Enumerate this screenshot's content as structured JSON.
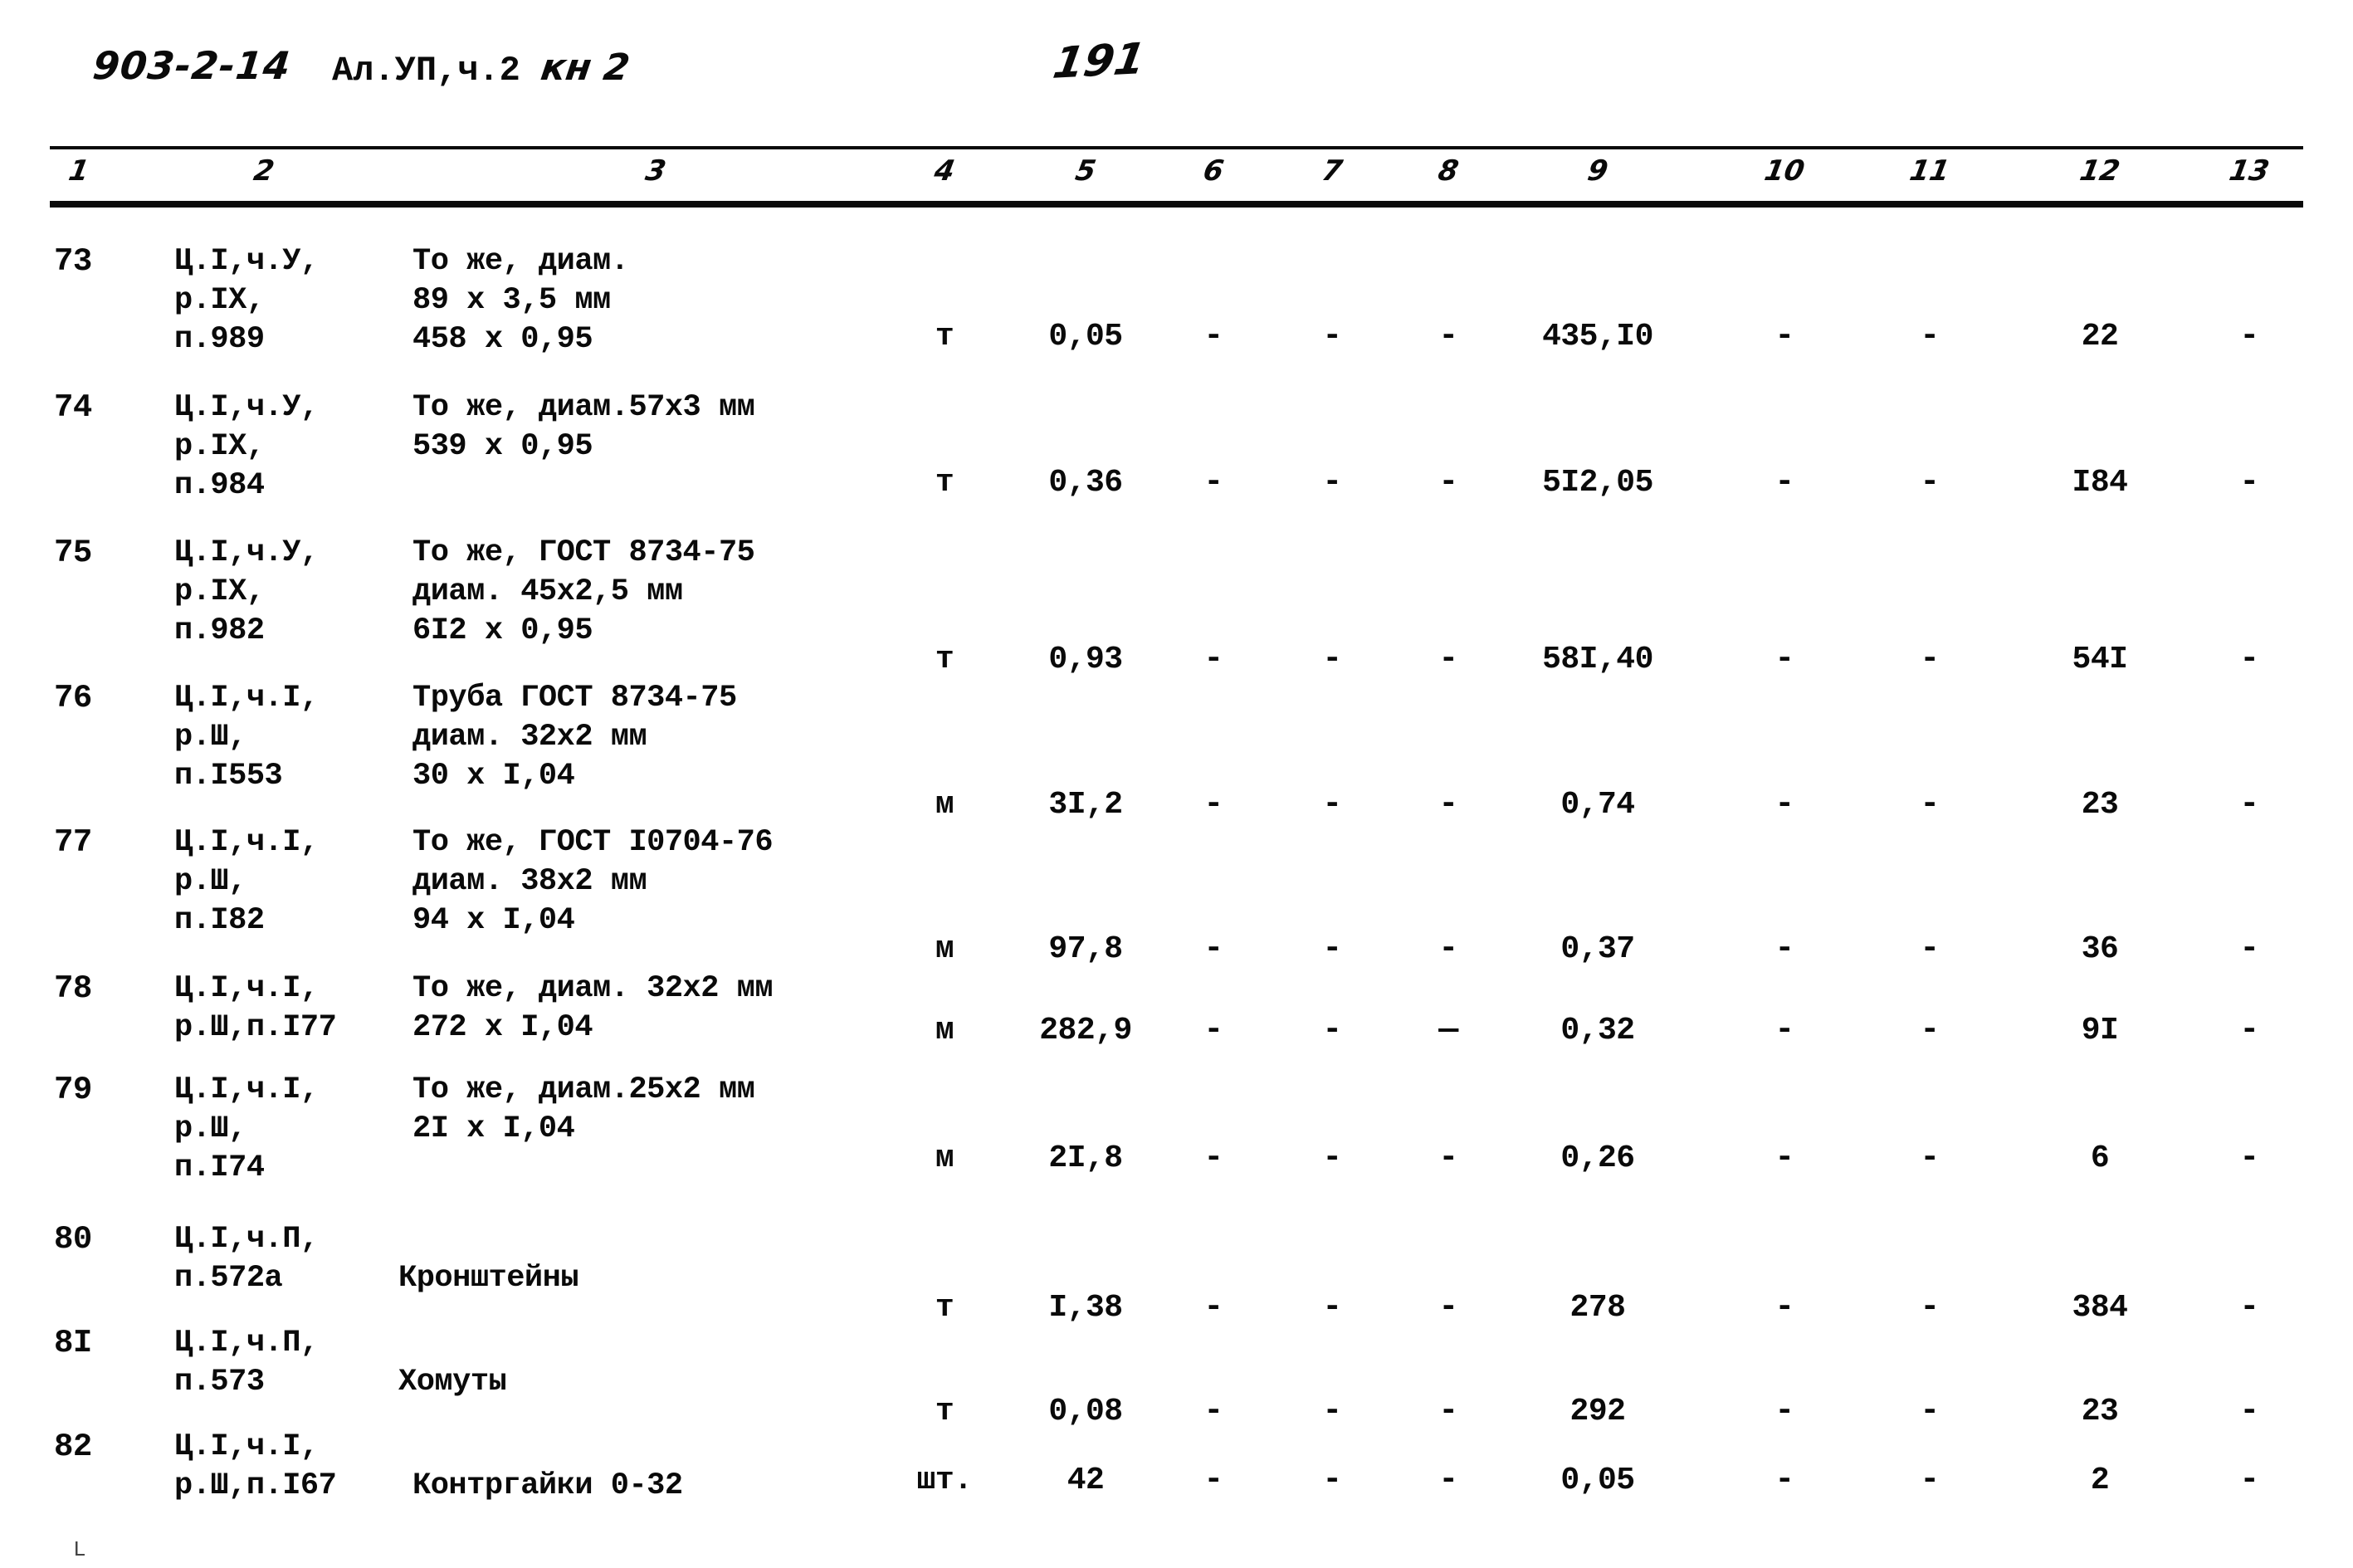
{
  "header": {
    "doc_code": "903-2-14",
    "album": "Ал.УП,ч.2",
    "album_hand": "кн 2",
    "page_number": "191"
  },
  "table": {
    "column_numbers": [
      "1",
      "2",
      "3",
      "4",
      "5",
      "6",
      "7",
      "8",
      "9",
      "10",
      "11",
      "12",
      "13"
    ],
    "rows": [
      {
        "n": "73",
        "code": [
          "Ц.I,ч.У,",
          "р.IX,",
          "п.989"
        ],
        "desc": [
          "То же, диам.",
          "89 x 3,5 мм",
          "458 x 0,95"
        ],
        "unit": "т",
        "c5": "0,05",
        "c6": "-",
        "c7": "-",
        "c8": "-",
        "c9": "435,I0",
        "c10": "-",
        "c11": "-",
        "c12": "22",
        "c13": "-"
      },
      {
        "n": "74",
        "code": [
          "Ц.I,ч.У,",
          "р.IX,",
          "п.984"
        ],
        "desc": [
          "То же, диам.57х3 мм",
          "539 x 0,95",
          ""
        ],
        "unit": "т",
        "c5": "0,36",
        "c6": "-",
        "c7": "-",
        "c8": "-",
        "c9": "5I2,05",
        "c10": "-",
        "c11": "-",
        "c12": "I84",
        "c13": "-"
      },
      {
        "n": "75",
        "code": [
          "Ц.I,ч.У,",
          "р.IX,",
          "п.982"
        ],
        "desc": [
          "То же, ГОСТ 8734-75",
          "диам. 45х2,5 мм",
          "6I2 x 0,95"
        ],
        "unit": "т",
        "c5": "0,93",
        "c6": "-",
        "c7": "-",
        "c8": "-",
        "c9": "58I,40",
        "c10": "-",
        "c11": "-",
        "c12": "54I",
        "c13": "-"
      },
      {
        "n": "76",
        "code": [
          "Ц.I,ч.I,",
          "р.Ш,",
          "п.I553"
        ],
        "desc": [
          "Труба ГОСТ 8734-75",
          "диам. 32х2 мм",
          "30 x I,04"
        ],
        "unit": "м",
        "c5": "3I,2",
        "c6": "-",
        "c7": "-",
        "c8": "-",
        "c9": "0,74",
        "c10": "-",
        "c11": "-",
        "c12": "23",
        "c13": "-"
      },
      {
        "n": "77",
        "code": [
          "Ц.I,ч.I,",
          "р.Ш,",
          "п.I82"
        ],
        "desc": [
          "То же, ГОСТ I0704-76",
          "диам. 38х2 мм",
          "94 x I,04"
        ],
        "unit": "м",
        "c5": "97,8",
        "c6": "-",
        "c7": "-",
        "c8": "-",
        "c9": "0,37",
        "c10": "-",
        "c11": "-",
        "c12": "36",
        "c13": "-"
      },
      {
        "n": "78",
        "code": [
          "Ц.I,ч.I,",
          "р.Ш,п.I77",
          ""
        ],
        "desc": [
          "То же, диам. 32х2 мм",
          "272 x I,04",
          ""
        ],
        "unit": "м",
        "c5": "282,9",
        "c6": "-",
        "c7": "-",
        "c8": "—",
        "c9": "0,32",
        "c10": "-",
        "c11": "-",
        "c12": "9I",
        "c13": "-"
      },
      {
        "n": "79",
        "code": [
          "Ц.I,ч.I,",
          "р.Ш,",
          "п.I74"
        ],
        "desc": [
          "То же, диам.25х2 мм",
          "2I x I,04",
          ""
        ],
        "unit": "м",
        "c5": "2I,8",
        "c6": "-",
        "c7": "-",
        "c8": "-",
        "c9": "0,26",
        "c10": "-",
        "c11": "-",
        "c12": "6",
        "c13": "-"
      },
      {
        "n": "80",
        "code": [
          "Ц.I,ч.П,",
          "п.572а",
          ""
        ],
        "desc": [
          "Кронштейны",
          "",
          ""
        ],
        "unit": "т",
        "c5": "I,38",
        "c6": "-",
        "c7": "-",
        "c8": "-",
        "c9": "278",
        "c10": "-",
        "c11": "-",
        "c12": "384",
        "c13": "-"
      },
      {
        "n": "8I",
        "code": [
          "Ц.I,ч.П,",
          "п.573",
          ""
        ],
        "desc": [
          "Хомуты",
          "",
          ""
        ],
        "unit": "т",
        "c5": "0,08",
        "c6": "-",
        "c7": "-",
        "c8": "-",
        "c9": "292",
        "c10": "-",
        "c11": "-",
        "c12": "23",
        "c13": "-"
      },
      {
        "n": "82",
        "code": [
          "Ц.I,ч.I,",
          "р.Ш,п.I67",
          ""
        ],
        "desc": [
          "Контргайки 0-32",
          "",
          ""
        ],
        "unit": "шт.",
        "c5": "42",
        "c6": "-",
        "c7": "-",
        "c8": "-",
        "c9": "0,05",
        "c10": "-",
        "c11": "-",
        "c12": "2",
        "c13": "-"
      }
    ]
  }
}
